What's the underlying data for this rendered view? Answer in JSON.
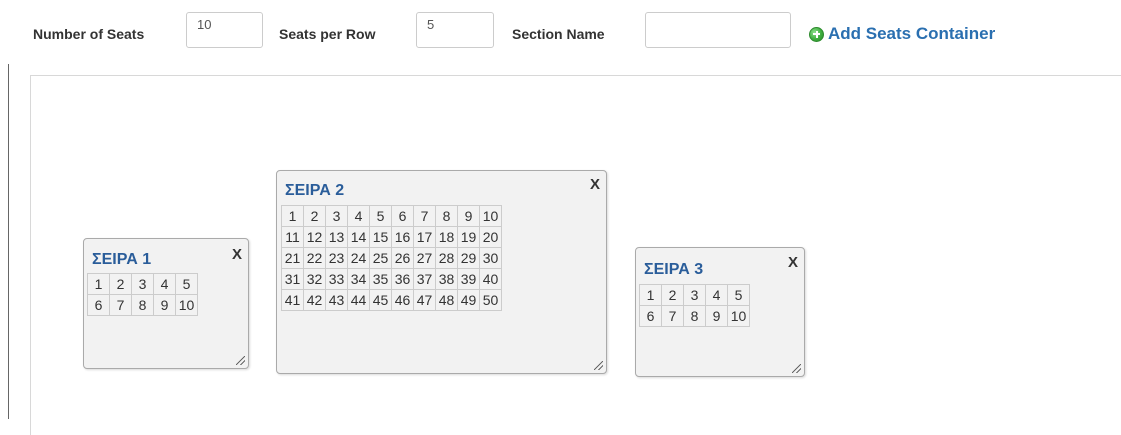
{
  "toolbar": {
    "num_seats_label": "Number of Seats",
    "num_seats_value": "10",
    "seats_per_row_label": "Seats per Row",
    "seats_per_row_value": "5",
    "section_name_label": "Section Name",
    "section_name_value": "",
    "add_button_label": "Add Seats Container",
    "add_icon": "plus-circle-icon",
    "add_color": "#2a6fb0"
  },
  "containers": [
    {
      "title": "ΣΕΙΡΑ 1",
      "close_label": "X",
      "rows": [
        [
          "1",
          "2",
          "3",
          "4",
          "5"
        ],
        [
          "6",
          "7",
          "8",
          "9",
          "10"
        ]
      ]
    },
    {
      "title": "ΣΕΙΡΑ 2",
      "close_label": "X",
      "rows": [
        [
          "1",
          "2",
          "3",
          "4",
          "5",
          "6",
          "7",
          "8",
          "9",
          "10"
        ],
        [
          "11",
          "12",
          "13",
          "14",
          "15",
          "16",
          "17",
          "18",
          "19",
          "20"
        ],
        [
          "21",
          "22",
          "23",
          "24",
          "25",
          "26",
          "27",
          "28",
          "29",
          "30"
        ],
        [
          "31",
          "32",
          "33",
          "34",
          "35",
          "36",
          "37",
          "38",
          "39",
          "40"
        ],
        [
          "41",
          "42",
          "43",
          "44",
          "45",
          "46",
          "47",
          "48",
          "49",
          "50"
        ]
      ]
    },
    {
      "title": "ΣΕΙΡΑ 3",
      "close_label": "X",
      "rows": [
        [
          "1",
          "2",
          "3",
          "4",
          "5"
        ],
        [
          "6",
          "7",
          "8",
          "9",
          "10"
        ]
      ]
    }
  ]
}
